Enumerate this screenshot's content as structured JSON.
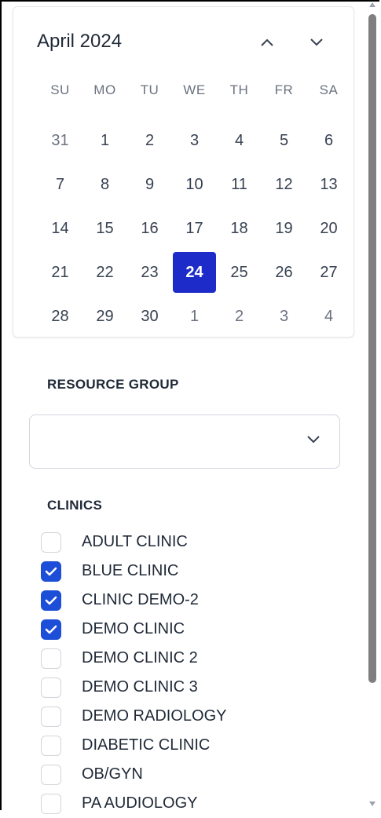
{
  "calendar": {
    "month_title": "April 2024",
    "weekdays": [
      "SU",
      "MO",
      "TU",
      "WE",
      "TH",
      "FR",
      "SA"
    ],
    "weeks": [
      [
        "31",
        "1",
        "2",
        "3",
        "4",
        "5",
        "6"
      ],
      [
        "7",
        "8",
        "9",
        "10",
        "11",
        "12",
        "13"
      ],
      [
        "14",
        "15",
        "16",
        "17",
        "18",
        "19",
        "20"
      ],
      [
        "21",
        "22",
        "23",
        "24",
        "25",
        "26",
        "27"
      ],
      [
        "28",
        "29",
        "30",
        "1",
        "2",
        "3",
        "4"
      ]
    ],
    "selected_day": "24"
  },
  "resource_group": {
    "label": "RESOURCE GROUP",
    "value": ""
  },
  "clinics": {
    "label": "CLINICS",
    "items": [
      {
        "label": "ADULT CLINIC",
        "checked": false
      },
      {
        "label": "BLUE CLINIC",
        "checked": true
      },
      {
        "label": "CLINIC DEMO-2",
        "checked": true
      },
      {
        "label": "DEMO CLINIC",
        "checked": true
      },
      {
        "label": "DEMO CLINIC 2",
        "checked": false
      },
      {
        "label": "DEMO CLINIC 3",
        "checked": false
      },
      {
        "label": "DEMO RADIOLOGY",
        "checked": false
      },
      {
        "label": "DIABETIC CLINIC",
        "checked": false
      },
      {
        "label": "OB/GYN",
        "checked": false
      },
      {
        "label": "PA AUDIOLOGY",
        "checked": false
      }
    ]
  },
  "colors": {
    "selected_day_bg": "#1d2cc9",
    "checkbox_checked": "#1d4ed8"
  }
}
